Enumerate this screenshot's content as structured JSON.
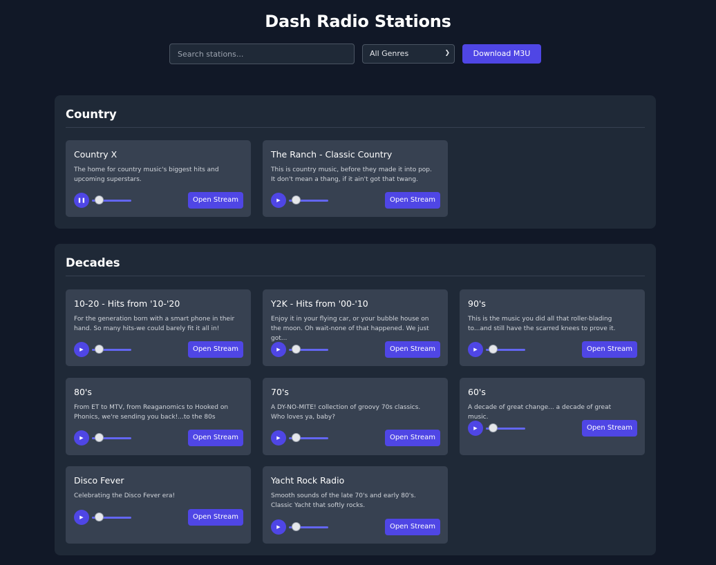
{
  "header": {
    "title": "Dash Radio Stations"
  },
  "controls": {
    "search_placeholder": "Search stations...",
    "genre_selected": "All Genres",
    "download_label": "Download M3U"
  },
  "open_label": "Open Stream",
  "sections": [
    {
      "title": "Country",
      "stations": [
        {
          "name": "Country X",
          "desc": "The home for country music's biggest hits and upcoming superstars.",
          "state": "playing"
        },
        {
          "name": "The Ranch - Classic Country",
          "desc": "This is country music, before they made it into pop. It don't mean a thang, if it ain't got that twang.",
          "state": "paused"
        }
      ]
    },
    {
      "title": "Decades",
      "stations": [
        {
          "name": "10-20 - Hits from '10-'20",
          "desc": "For the generation born with a smart phone in their hand. So many hits-we could barely fit it all in!",
          "state": "paused"
        },
        {
          "name": "Y2K - Hits from '00-'10",
          "desc": "Enjoy it in your flying car, or your bubble house on the moon. Oh wait-none of that happened. We just got...",
          "state": "paused"
        },
        {
          "name": "90's",
          "desc": "This is the music you did all that roller-blading to...and still have the scarred knees to prove it.",
          "state": "paused"
        },
        {
          "name": "80's",
          "desc": "From ET to MTV, from Reaganomics to Hooked on Phonics, we're sending you back!...to the 80s",
          "state": "paused"
        },
        {
          "name": "70's",
          "desc": "A DY-NO-MITE! collection of groovy 70s classics. Who loves ya, baby?",
          "state": "paused"
        },
        {
          "name": "60's",
          "desc": "A decade of great change... a decade of great music.",
          "state": "paused"
        },
        {
          "name": "Disco Fever",
          "desc": "Celebrating the Disco Fever era!",
          "state": "paused"
        },
        {
          "name": "Yacht Rock Radio",
          "desc": "Smooth sounds of the late 70's and early 80's. Classic Yacht that softly rocks.",
          "state": "paused"
        }
      ]
    }
  ],
  "colors": {
    "accent": "#4f46e5",
    "background": "#111827",
    "panel": "#1f2937",
    "card": "#374151"
  },
  "icons": {
    "play": "play-icon",
    "pause": "pause-icon"
  }
}
